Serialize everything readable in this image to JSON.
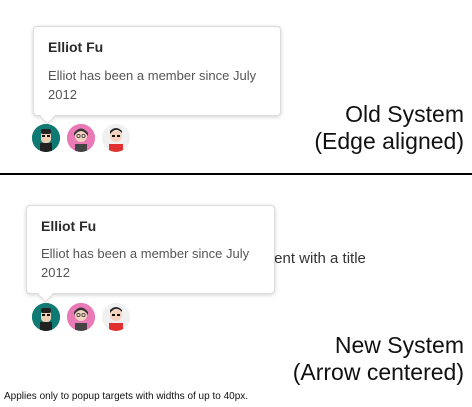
{
  "old_system": {
    "popup_title": "Elliot Fu",
    "popup_body": "Elliot has been a member since July 2012",
    "caption_line1": "Old System",
    "caption_line2": "(Edge aligned)"
  },
  "new_system": {
    "popup_title": "Elliot Fu",
    "popup_body": "Elliot has been a member since July 2012",
    "background_text": "tent with a title",
    "caption_line1": "New System",
    "caption_line2": "(Arrow centered)"
  },
  "footnote": "Applies only to popup targets with widths of up to 40px.",
  "avatars": [
    {
      "name": "avatar-1",
      "bg": "#0f7a73"
    },
    {
      "name": "avatar-2",
      "bg": "#e97ab5"
    },
    {
      "name": "avatar-3",
      "bg": "#f0f0f0"
    }
  ]
}
